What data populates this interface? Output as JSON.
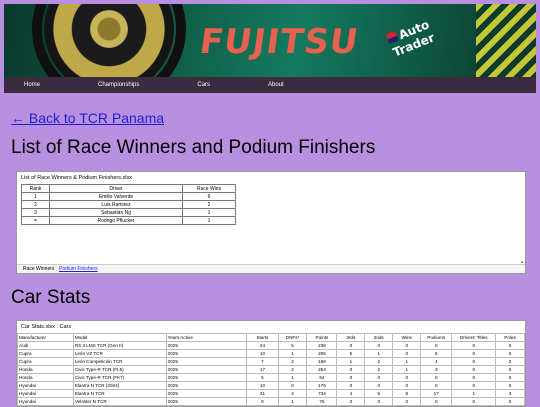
{
  "banner": {
    "logo_text": "FUJITSU",
    "auto_trader_line1": "Auto",
    "auto_trader_line2": "Trader"
  },
  "nav": [
    "Home",
    "Championships",
    "Cars",
    "About"
  ],
  "back_link": "← Back to TCR Panama",
  "heading_winners": "List of Race Winners and Podium Finishers",
  "winners_sheet": {
    "title": "List of Race Winners & Podium Finishers.xlsx",
    "columns": [
      "Rank",
      "Driver",
      "Race Wins"
    ],
    "rows": [
      [
        "1",
        "Emilio Valverde",
        "6"
      ],
      [
        "2",
        "Luis Ramirez",
        "2"
      ],
      [
        "3",
        "Sebastián Ng",
        "1"
      ],
      [
        "=",
        "Rodrigo Pflucker",
        "1"
      ]
    ],
    "tabs": [
      "Race Winners",
      "Podium Finishers"
    ]
  },
  "heading_cars": "Car Stats",
  "cars_sheet": {
    "title": "Car Stats.xlsx : Cars",
    "columns": [
      "Manufacturer",
      "Model",
      "Years Active",
      "Starts",
      "DNFs*",
      "Points",
      "3rds",
      "2nds",
      "Wins",
      "Podiums",
      "Drivers' Titles",
      "Poles",
      "FL"
    ],
    "rows": [
      [
        "Audi",
        "RS 3 LMS TCR (Gen II)",
        "2025",
        "24",
        "5",
        "236",
        "0",
        "0",
        "0",
        "0",
        "0",
        "0",
        "0"
      ],
      [
        "Cupra",
        "León VZ TCR",
        "2025",
        "10",
        "1",
        "205",
        "5",
        "1",
        "0",
        "6",
        "0",
        "0",
        "2"
      ],
      [
        "Cupra",
        "León Competición TCR",
        "2025",
        "7",
        "2",
        "168",
        "1",
        "2",
        "1",
        "4",
        "0",
        "2",
        "2"
      ],
      [
        "Honda",
        "Civic Type-R TCR (FL5)",
        "2025",
        "17",
        "2",
        "254",
        "0",
        "2",
        "1",
        "3",
        "0",
        "0",
        "1"
      ],
      [
        "Honda",
        "Civic Type-R TCR (FK7)",
        "2025",
        "5",
        "1",
        "64",
        "0",
        "0",
        "0",
        "0",
        "0",
        "0",
        "0"
      ],
      [
        "Hyundai",
        "Elantra N TCR (2024)",
        "2025",
        "10",
        "0",
        "176",
        "0",
        "0",
        "0",
        "0",
        "0",
        "0",
        "0"
      ],
      [
        "Hyundai",
        "Elantra N TCR",
        "2025",
        "31",
        "4",
        "734",
        "4",
        "5",
        "8",
        "17",
        "1",
        "3",
        "6"
      ],
      [
        "Hyundai",
        "Veloster N TCR",
        "2025",
        "8",
        "1",
        "76",
        "0",
        "0",
        "0",
        "0",
        "0",
        "0",
        "0"
      ]
    ]
  }
}
